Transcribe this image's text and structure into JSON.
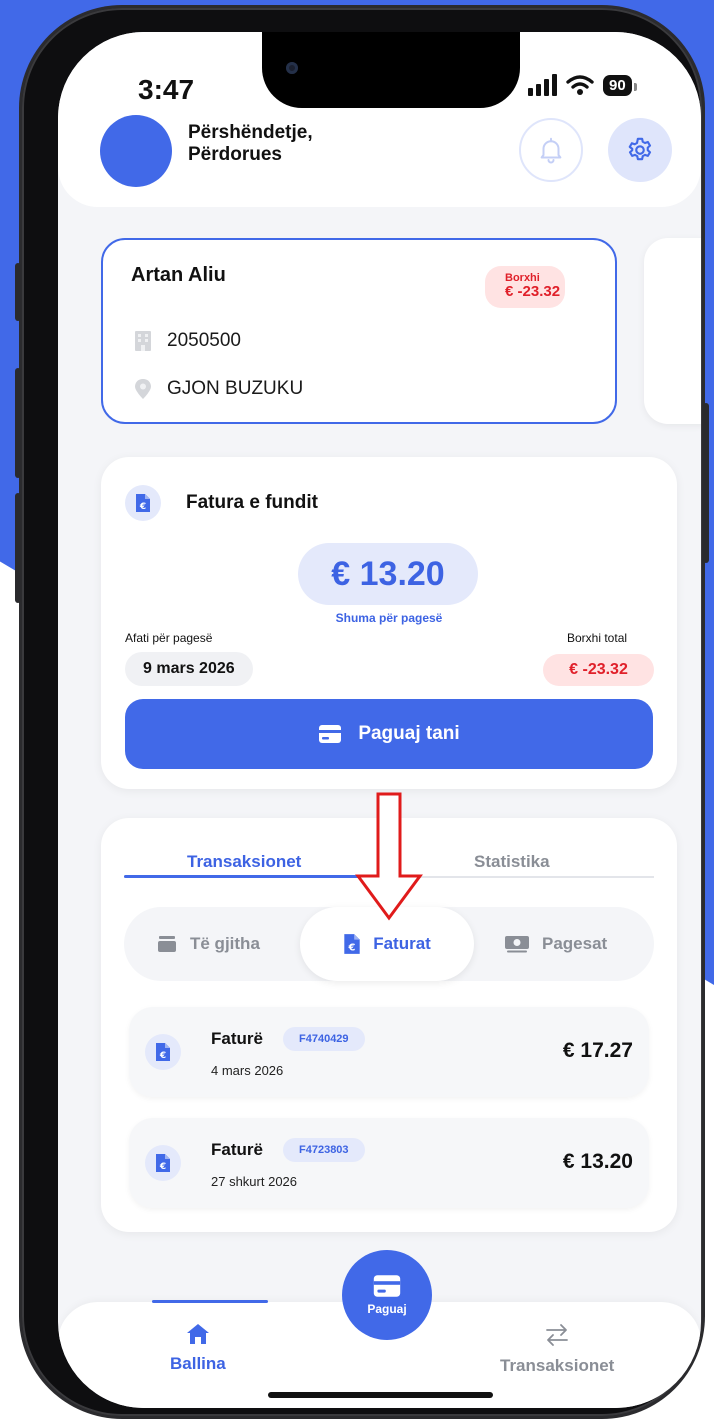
{
  "status_bar": {
    "time": "3:47",
    "battery": "90"
  },
  "header": {
    "greeting_line1": "Përshëndetje,",
    "greeting_line2": "Përdorues"
  },
  "account": {
    "name": "Artan Aliu",
    "debt_label": "Borxhi",
    "debt_value": "€ -23.32",
    "number": "2050500",
    "street": "GJON BUZUKU"
  },
  "latest_invoice": {
    "title": "Fatura e fundit",
    "amount": "€ 13.20",
    "amount_label": "Shuma për pagesë",
    "due_label": "Afati për pagesë",
    "due_date": "9 mars 2026",
    "total_label": "Borxhi total",
    "total_value": "€ -23.32",
    "pay_button": "Paguaj tani"
  },
  "transactions": {
    "tabs": [
      {
        "label": "Transaksionet",
        "active": true
      },
      {
        "label": "Statistika",
        "active": false
      }
    ],
    "filters": [
      {
        "label": "Të gjitha",
        "icon": "stack-icon",
        "active": false
      },
      {
        "label": "Faturat",
        "icon": "invoice-icon",
        "active": true
      },
      {
        "label": "Pagesat",
        "icon": "cash-icon",
        "active": false
      }
    ],
    "items": [
      {
        "title": "Faturë",
        "code": "F4740429",
        "date": "4 mars 2026",
        "amount": "€ 17.27"
      },
      {
        "title": "Faturë",
        "code": "F4723803",
        "date": "27 shkurt 2026",
        "amount": "€ 13.20"
      }
    ]
  },
  "bottom_nav": {
    "home": "Ballina",
    "pay": "Paguaj",
    "transactions": "Transaksionet"
  },
  "colors": {
    "primary": "#4169e8",
    "danger": "#e0202a",
    "danger_bg": "#ffe3e3",
    "tint": "#e4e9fb"
  }
}
